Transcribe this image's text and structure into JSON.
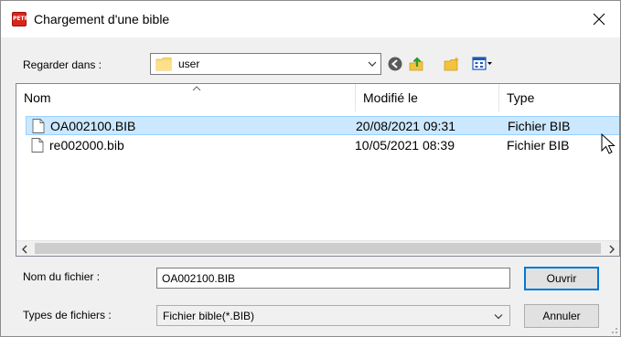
{
  "window": {
    "title": "Chargement d'une bible",
    "app_icon_text": "PETRA"
  },
  "lookin": {
    "label": "Regarder dans :",
    "value": "user"
  },
  "columns": {
    "name": "Nom",
    "modified": "Modifié le",
    "type": "Type"
  },
  "files": [
    {
      "name": "OA002100.BIB",
      "modified": "20/08/2021 09:31",
      "type": "Fichier BIB"
    },
    {
      "name": "re002000.bib",
      "modified": "10/05/2021 08:39",
      "type": "Fichier BIB"
    }
  ],
  "filename": {
    "label": "Nom du fichier :",
    "value": "OA002100.BIB"
  },
  "filetypes": {
    "label": "Types de fichiers :",
    "value": "Fichier bible(*.BIB)"
  },
  "buttons": {
    "open": "Ouvrir",
    "cancel": "Annuler"
  },
  "colors": {
    "selection": "#cce8ff",
    "accent": "#0078d7",
    "app_icon": "#d9261c"
  }
}
